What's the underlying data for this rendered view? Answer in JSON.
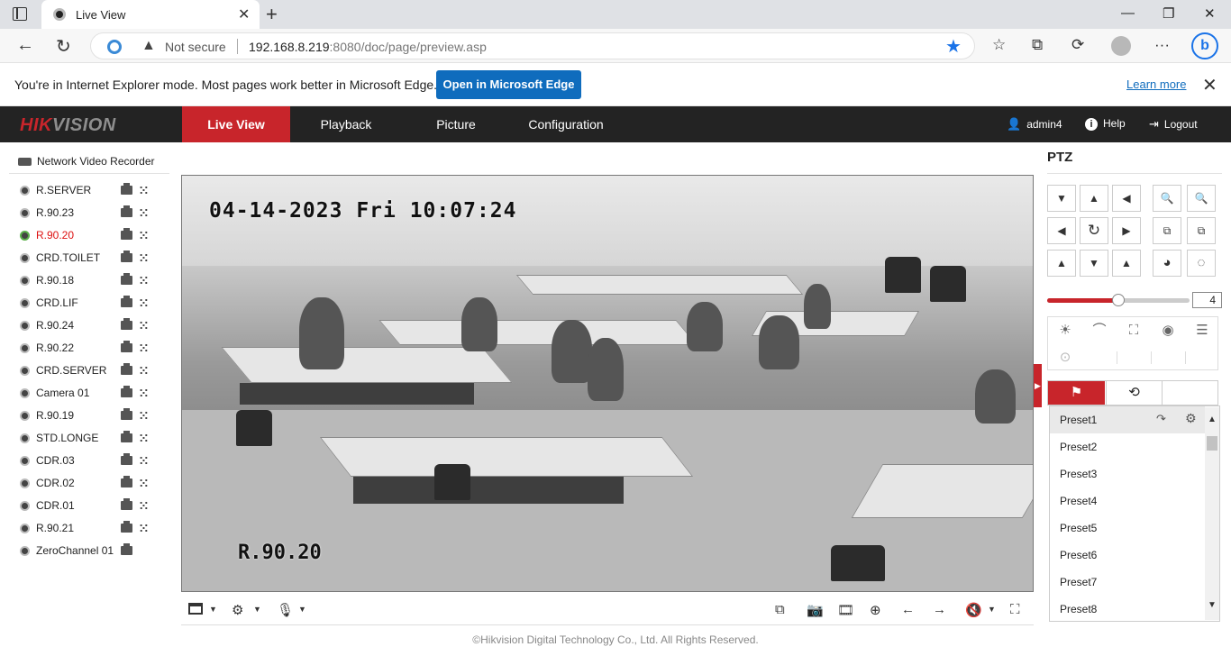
{
  "browser": {
    "tab_title": "Live View",
    "url_warning": "Not secure",
    "url_host": "192.168.8.219",
    "url_rest": ":8080/doc/page/preview.asp"
  },
  "ie_bar": {
    "message": "You're in Internet Explorer mode. Most pages work better in Microsoft Edge.",
    "open_button": "Open in Microsoft Edge",
    "learn_more": "Learn more"
  },
  "app": {
    "nav": [
      "Live View",
      "Playback",
      "Picture",
      "Configuration"
    ],
    "active_nav": "Live View",
    "accent": "#c8252b",
    "user": "admin4",
    "help": "Help",
    "logout": "Logout"
  },
  "device": {
    "title": "Network Video Recorder",
    "cameras": [
      {
        "name": "R.SERVER"
      },
      {
        "name": "R.90.23"
      },
      {
        "name": "R.90.20",
        "active": true
      },
      {
        "name": "CRD.TOILET"
      },
      {
        "name": "R.90.18"
      },
      {
        "name": "CRD.LIF"
      },
      {
        "name": "R.90.24"
      },
      {
        "name": "R.90.22"
      },
      {
        "name": "CRD.SERVER"
      },
      {
        "name": "Camera 01"
      },
      {
        "name": "R.90.19"
      },
      {
        "name": "STD.LONGE"
      },
      {
        "name": "CDR.03"
      },
      {
        "name": "CDR.02"
      },
      {
        "name": "CDR.01"
      },
      {
        "name": "R.90.21"
      },
      {
        "name": "ZeroChannel 01",
        "no_ptz": true
      }
    ]
  },
  "video": {
    "osd_timestamp": "04-14-2023 Fri 10:07:24",
    "osd_channel": "R.90.20"
  },
  "ptz": {
    "title": "PTZ",
    "speed": "4",
    "speed_fraction": 0.5,
    "presets": [
      "Preset1",
      "Preset2",
      "Preset3",
      "Preset4",
      "Preset5",
      "Preset6",
      "Preset7",
      "Preset8"
    ]
  },
  "footer": "©Hikvision Digital Technology Co., Ltd. All Rights Reserved."
}
